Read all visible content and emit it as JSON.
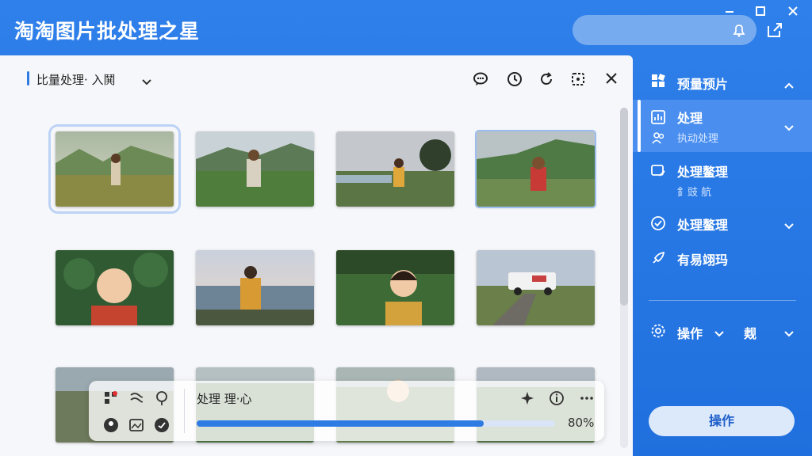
{
  "app": {
    "title": "淘淘图片批处理之星"
  },
  "toolbar": {
    "label": "比量处理· 入鬨"
  },
  "bottom": {
    "status": "处理 理·心",
    "progress_pct": 80,
    "progress_label": "80%"
  },
  "sidebar": {
    "header": "预量预片",
    "items": [
      {
        "label": "处理",
        "sub": "执动处理"
      },
      {
        "label": "处理鳌理",
        "sub": "釒豉 航"
      },
      {
        "label": "处理鳌理",
        "sub": ""
      },
      {
        "label": "有易翊玛",
        "sub": ""
      }
    ],
    "ops": {
      "left": "操作",
      "right": "觌"
    },
    "button": "操作"
  },
  "colors": {
    "accent": "#2f7be4",
    "panel": "#f6f7fa"
  },
  "icons": [
    "bell-icon",
    "share-icon",
    "minimize-icon",
    "maximize-icon",
    "close-icon"
  ]
}
